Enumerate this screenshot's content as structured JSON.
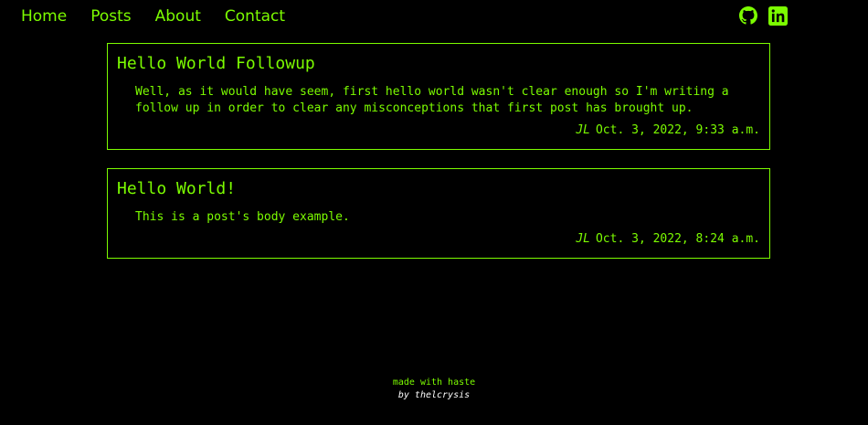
{
  "nav": {
    "links": [
      {
        "label": "Home"
      },
      {
        "label": "Posts"
      },
      {
        "label": "About"
      },
      {
        "label": "Contact"
      }
    ],
    "icons": [
      "github-icon",
      "linkedin-icon"
    ]
  },
  "posts": [
    {
      "title": "Hello World Followup",
      "body": "Well, as it would have seem, first hello world wasn't clear enough so I'm writing a follow up in order to clear any misconceptions that first post has brought up.",
      "author": "JL",
      "date": "Oct. 3, 2022, 9:33 a.m."
    },
    {
      "title": "Hello World!",
      "body": "This is a post's body example.",
      "author": "JL",
      "date": "Oct. 3, 2022, 8:24 a.m."
    }
  ],
  "footer": {
    "made_with": "made with haste",
    "by": "by thelcrysis"
  },
  "colors": {
    "background": "#000000",
    "accent": "#7cfc00",
    "footer_by": "#ffffff"
  }
}
